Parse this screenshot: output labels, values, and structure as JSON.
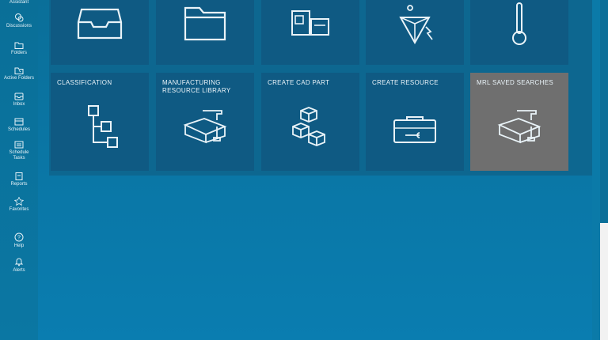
{
  "sidebar": {
    "items": [
      {
        "label": "Assistant",
        "icon": "assistant-icon"
      },
      {
        "label": "Discussions",
        "icon": "discussions-icon"
      },
      {
        "label": "Folders",
        "icon": "folder-icon"
      },
      {
        "label": "Active Folders",
        "icon": "active-folders-icon"
      },
      {
        "label": "Inbox",
        "icon": "inbox-icon"
      },
      {
        "label": "Schedules",
        "icon": "schedules-icon"
      },
      {
        "label": "Schedule Tasks",
        "icon": "schedule-tasks-icon"
      },
      {
        "label": "Reports",
        "icon": "reports-icon"
      },
      {
        "label": "Favorites",
        "icon": "star-icon"
      },
      {
        "label": "Help",
        "icon": "help-icon"
      },
      {
        "label": "Alerts",
        "icon": "bell-icon"
      }
    ]
  },
  "tiles_top": [
    {
      "icon": "inbox-tray-icon"
    },
    {
      "icon": "folder-icon"
    },
    {
      "icon": "cnc-machine-icon"
    },
    {
      "icon": "gem-tool-icon"
    },
    {
      "icon": "thermometer-icon"
    }
  ],
  "tiles": [
    {
      "label": "CLASSIFICATION",
      "icon": "hierarchy-icon"
    },
    {
      "label": "MANUFACTURING RESOURCE LIBRARY",
      "icon": "toolbox-icon"
    },
    {
      "label": "CREATE CAD PART",
      "icon": "cubes-icon"
    },
    {
      "label": "CREATE RESOURCE",
      "icon": "toolcase-icon"
    },
    {
      "label": "MRL SAVED SEARCHES",
      "icon": "toolbox-icon"
    }
  ],
  "colors": {
    "background": "#0a6d96",
    "tile": "#0f5a83",
    "tile_selected": "#6f6f6f"
  }
}
